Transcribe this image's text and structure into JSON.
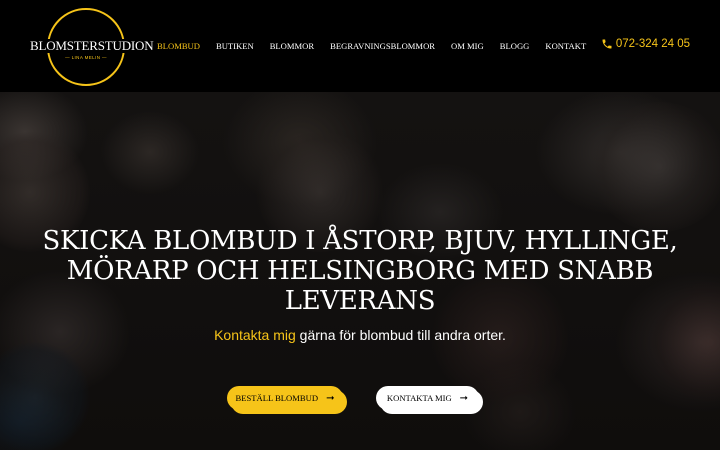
{
  "brand": {
    "name": "BLOMSTERSTUDION",
    "tagline": "— LINA MELIN —",
    "accent_color": "#f6c419"
  },
  "nav": {
    "items": [
      {
        "label": "BLOMBUD",
        "active": true
      },
      {
        "label": "BUTIKEN",
        "active": false
      },
      {
        "label": "BLOMMOR",
        "active": false
      },
      {
        "label": "BEGRAVNINGSBLOMMOR",
        "active": false
      },
      {
        "label": "OM MIG",
        "active": false
      },
      {
        "label": "BLOGG",
        "active": false
      },
      {
        "label": "KONTAKT",
        "active": false
      }
    ]
  },
  "phone": {
    "icon": "phone-icon",
    "number": "072-324 24 05"
  },
  "hero": {
    "title": "SKICKA BLOMBUD I ÅSTORP, BJUV, HYLLINGE, MÖRARP OCH HELSINGBORG MED SNABB LEVERANS",
    "sub_link": "Kontakta mig",
    "sub_rest": " gärna för blombud till andra orter.",
    "buttons": {
      "order_label": "BESTÄLL BLOMBUD",
      "contact_label": "KONTAKTA MIG",
      "arrow_icon": "arrow-right-icon"
    }
  }
}
